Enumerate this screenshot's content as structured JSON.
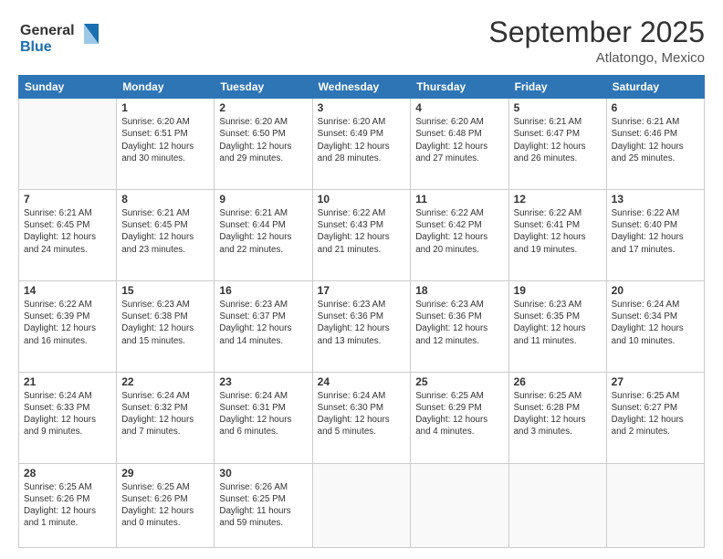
{
  "header": {
    "logo_line1": "General",
    "logo_line2": "Blue",
    "month": "September 2025",
    "location": "Atlatongo, Mexico"
  },
  "weekdays": [
    "Sunday",
    "Monday",
    "Tuesday",
    "Wednesday",
    "Thursday",
    "Friday",
    "Saturday"
  ],
  "weeks": [
    [
      {
        "day": "",
        "info": ""
      },
      {
        "day": "1",
        "info": "Sunrise: 6:20 AM\nSunset: 6:51 PM\nDaylight: 12 hours\nand 30 minutes."
      },
      {
        "day": "2",
        "info": "Sunrise: 6:20 AM\nSunset: 6:50 PM\nDaylight: 12 hours\nand 29 minutes."
      },
      {
        "day": "3",
        "info": "Sunrise: 6:20 AM\nSunset: 6:49 PM\nDaylight: 12 hours\nand 28 minutes."
      },
      {
        "day": "4",
        "info": "Sunrise: 6:20 AM\nSunset: 6:48 PM\nDaylight: 12 hours\nand 27 minutes."
      },
      {
        "day": "5",
        "info": "Sunrise: 6:21 AM\nSunset: 6:47 PM\nDaylight: 12 hours\nand 26 minutes."
      },
      {
        "day": "6",
        "info": "Sunrise: 6:21 AM\nSunset: 6:46 PM\nDaylight: 12 hours\nand 25 minutes."
      }
    ],
    [
      {
        "day": "7",
        "info": "Sunrise: 6:21 AM\nSunset: 6:45 PM\nDaylight: 12 hours\nand 24 minutes."
      },
      {
        "day": "8",
        "info": "Sunrise: 6:21 AM\nSunset: 6:45 PM\nDaylight: 12 hours\nand 23 minutes."
      },
      {
        "day": "9",
        "info": "Sunrise: 6:21 AM\nSunset: 6:44 PM\nDaylight: 12 hours\nand 22 minutes."
      },
      {
        "day": "10",
        "info": "Sunrise: 6:22 AM\nSunset: 6:43 PM\nDaylight: 12 hours\nand 21 minutes."
      },
      {
        "day": "11",
        "info": "Sunrise: 6:22 AM\nSunset: 6:42 PM\nDaylight: 12 hours\nand 20 minutes."
      },
      {
        "day": "12",
        "info": "Sunrise: 6:22 AM\nSunset: 6:41 PM\nDaylight: 12 hours\nand 19 minutes."
      },
      {
        "day": "13",
        "info": "Sunrise: 6:22 AM\nSunset: 6:40 PM\nDaylight: 12 hours\nand 17 minutes."
      }
    ],
    [
      {
        "day": "14",
        "info": "Sunrise: 6:22 AM\nSunset: 6:39 PM\nDaylight: 12 hours\nand 16 minutes."
      },
      {
        "day": "15",
        "info": "Sunrise: 6:23 AM\nSunset: 6:38 PM\nDaylight: 12 hours\nand 15 minutes."
      },
      {
        "day": "16",
        "info": "Sunrise: 6:23 AM\nSunset: 6:37 PM\nDaylight: 12 hours\nand 14 minutes."
      },
      {
        "day": "17",
        "info": "Sunrise: 6:23 AM\nSunset: 6:36 PM\nDaylight: 12 hours\nand 13 minutes."
      },
      {
        "day": "18",
        "info": "Sunrise: 6:23 AM\nSunset: 6:36 PM\nDaylight: 12 hours\nand 12 minutes."
      },
      {
        "day": "19",
        "info": "Sunrise: 6:23 AM\nSunset: 6:35 PM\nDaylight: 12 hours\nand 11 minutes."
      },
      {
        "day": "20",
        "info": "Sunrise: 6:24 AM\nSunset: 6:34 PM\nDaylight: 12 hours\nand 10 minutes."
      }
    ],
    [
      {
        "day": "21",
        "info": "Sunrise: 6:24 AM\nSunset: 6:33 PM\nDaylight: 12 hours\nand 9 minutes."
      },
      {
        "day": "22",
        "info": "Sunrise: 6:24 AM\nSunset: 6:32 PM\nDaylight: 12 hours\nand 7 minutes."
      },
      {
        "day": "23",
        "info": "Sunrise: 6:24 AM\nSunset: 6:31 PM\nDaylight: 12 hours\nand 6 minutes."
      },
      {
        "day": "24",
        "info": "Sunrise: 6:24 AM\nSunset: 6:30 PM\nDaylight: 12 hours\nand 5 minutes."
      },
      {
        "day": "25",
        "info": "Sunrise: 6:25 AM\nSunset: 6:29 PM\nDaylight: 12 hours\nand 4 minutes."
      },
      {
        "day": "26",
        "info": "Sunrise: 6:25 AM\nSunset: 6:28 PM\nDaylight: 12 hours\nand 3 minutes."
      },
      {
        "day": "27",
        "info": "Sunrise: 6:25 AM\nSunset: 6:27 PM\nDaylight: 12 hours\nand 2 minutes."
      }
    ],
    [
      {
        "day": "28",
        "info": "Sunrise: 6:25 AM\nSunset: 6:26 PM\nDaylight: 12 hours\nand 1 minute."
      },
      {
        "day": "29",
        "info": "Sunrise: 6:25 AM\nSunset: 6:26 PM\nDaylight: 12 hours\nand 0 minutes."
      },
      {
        "day": "30",
        "info": "Sunrise: 6:26 AM\nSunset: 6:25 PM\nDaylight: 11 hours\nand 59 minutes."
      },
      {
        "day": "",
        "info": ""
      },
      {
        "day": "",
        "info": ""
      },
      {
        "day": "",
        "info": ""
      },
      {
        "day": "",
        "info": ""
      }
    ]
  ]
}
